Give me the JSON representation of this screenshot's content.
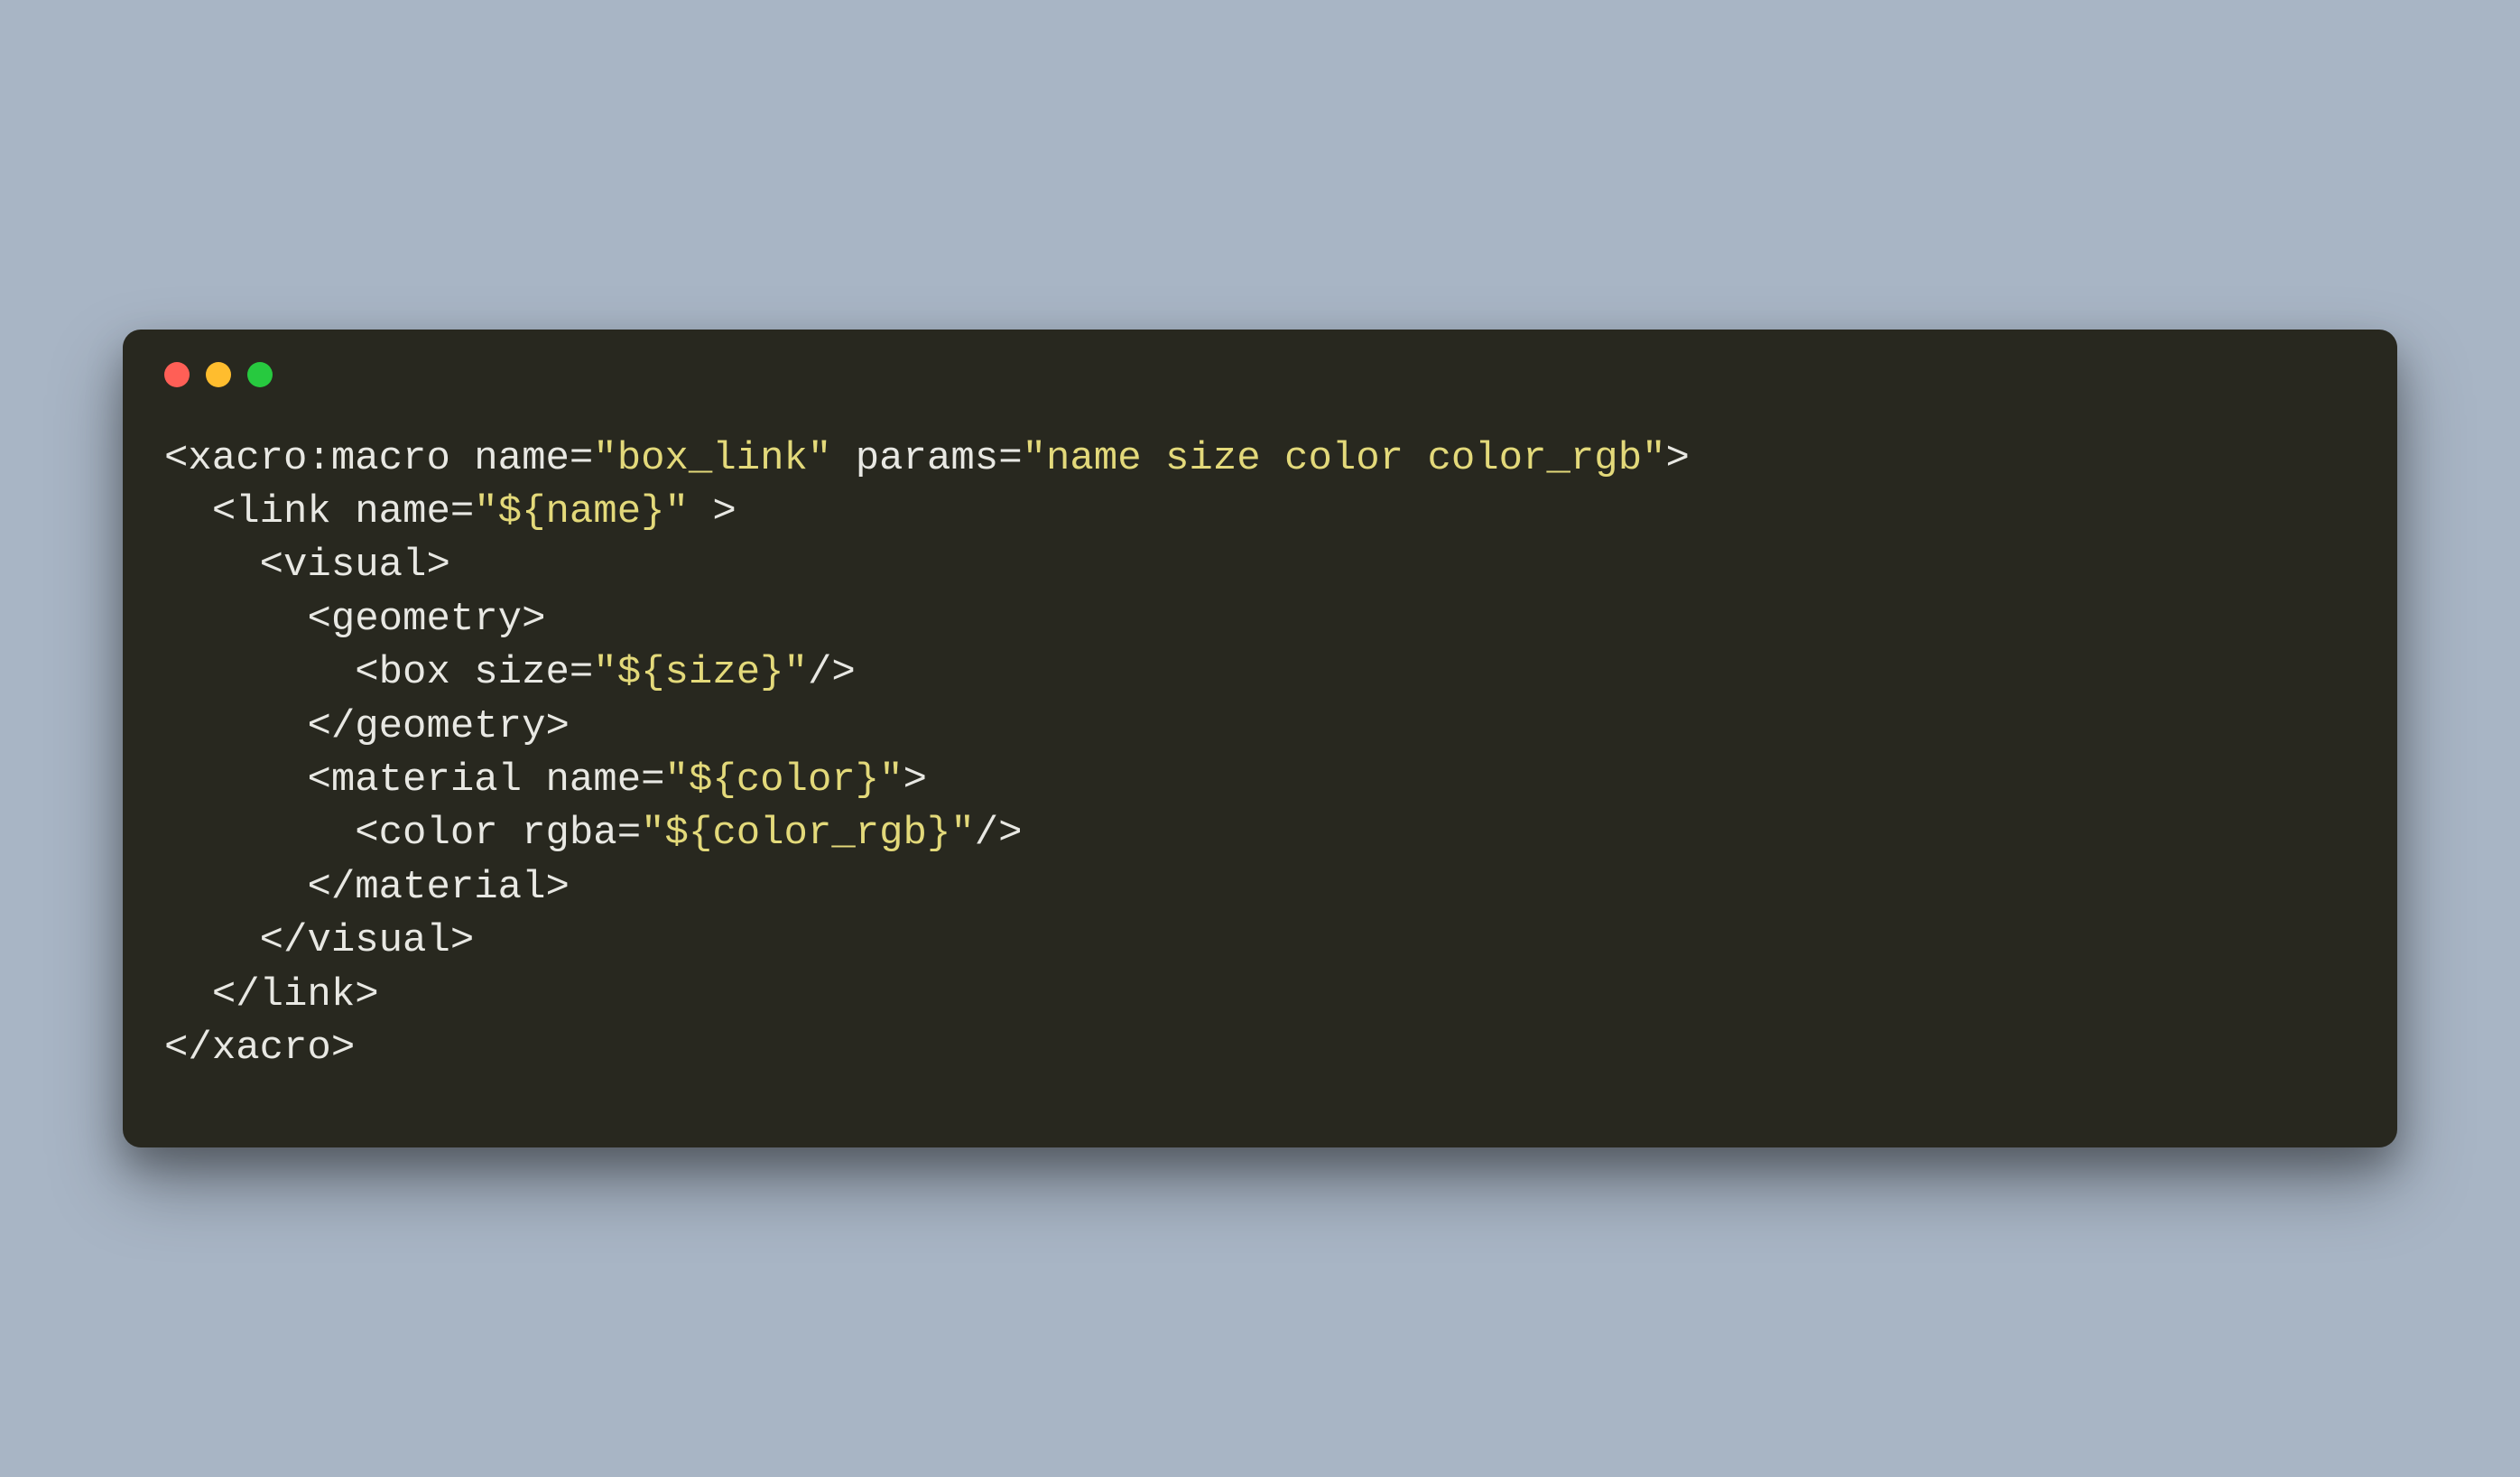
{
  "window": {
    "controls": {
      "close": "close",
      "minimize": "minimize",
      "maximize": "maximize"
    }
  },
  "code": {
    "lines": [
      {
        "indent": 0,
        "tokens": [
          {
            "t": "punct",
            "v": "<"
          },
          {
            "t": "tag",
            "v": "xacro:macro"
          },
          {
            "t": "punct",
            "v": " "
          },
          {
            "t": "attr",
            "v": "name"
          },
          {
            "t": "punct",
            "v": "="
          },
          {
            "t": "string",
            "v": "\"box_link\""
          },
          {
            "t": "punct",
            "v": " "
          },
          {
            "t": "attr",
            "v": "params"
          },
          {
            "t": "punct",
            "v": "="
          },
          {
            "t": "string",
            "v": "\"name size color color_rgb\""
          },
          {
            "t": "punct",
            "v": ">"
          }
        ]
      },
      {
        "indent": 1,
        "tokens": [
          {
            "t": "punct",
            "v": "<"
          },
          {
            "t": "tag",
            "v": "link"
          },
          {
            "t": "punct",
            "v": " "
          },
          {
            "t": "attr",
            "v": "name"
          },
          {
            "t": "punct",
            "v": "="
          },
          {
            "t": "string",
            "v": "\"${name}\""
          },
          {
            "t": "punct",
            "v": " >"
          }
        ]
      },
      {
        "indent": 2,
        "tokens": [
          {
            "t": "punct",
            "v": "<"
          },
          {
            "t": "tag",
            "v": "visual"
          },
          {
            "t": "punct",
            "v": ">"
          }
        ]
      },
      {
        "indent": 3,
        "tokens": [
          {
            "t": "punct",
            "v": "<"
          },
          {
            "t": "tag",
            "v": "geometry"
          },
          {
            "t": "punct",
            "v": ">"
          }
        ]
      },
      {
        "indent": 4,
        "tokens": [
          {
            "t": "punct",
            "v": "<"
          },
          {
            "t": "tag",
            "v": "box"
          },
          {
            "t": "punct",
            "v": " "
          },
          {
            "t": "attr",
            "v": "size"
          },
          {
            "t": "punct",
            "v": "="
          },
          {
            "t": "string",
            "v": "\"${size}\""
          },
          {
            "t": "punct",
            "v": "/>"
          }
        ]
      },
      {
        "indent": 3,
        "tokens": [
          {
            "t": "punct",
            "v": "</"
          },
          {
            "t": "tag",
            "v": "geometry"
          },
          {
            "t": "punct",
            "v": ">"
          }
        ]
      },
      {
        "indent": 3,
        "tokens": [
          {
            "t": "punct",
            "v": "<"
          },
          {
            "t": "tag",
            "v": "material"
          },
          {
            "t": "punct",
            "v": " "
          },
          {
            "t": "attr",
            "v": "name"
          },
          {
            "t": "punct",
            "v": "="
          },
          {
            "t": "string",
            "v": "\"${color}\""
          },
          {
            "t": "punct",
            "v": ">"
          }
        ]
      },
      {
        "indent": 4,
        "tokens": [
          {
            "t": "punct",
            "v": "<"
          },
          {
            "t": "tag",
            "v": "color"
          },
          {
            "t": "punct",
            "v": " "
          },
          {
            "t": "attr",
            "v": "rgba"
          },
          {
            "t": "punct",
            "v": "="
          },
          {
            "t": "string",
            "v": "\"${color_rgb}\""
          },
          {
            "t": "punct",
            "v": "/>"
          }
        ]
      },
      {
        "indent": 3,
        "tokens": [
          {
            "t": "punct",
            "v": "</"
          },
          {
            "t": "tag",
            "v": "material"
          },
          {
            "t": "punct",
            "v": ">"
          }
        ]
      },
      {
        "indent": 2,
        "tokens": [
          {
            "t": "punct",
            "v": "</"
          },
          {
            "t": "tag",
            "v": "visual"
          },
          {
            "t": "punct",
            "v": ">"
          }
        ]
      },
      {
        "indent": 1,
        "tokens": [
          {
            "t": "punct",
            "v": "</"
          },
          {
            "t": "tag",
            "v": "link"
          },
          {
            "t": "punct",
            "v": ">"
          }
        ]
      },
      {
        "indent": 0,
        "tokens": [
          {
            "t": "punct",
            "v": "</"
          },
          {
            "t": "tag",
            "v": "xacro"
          },
          {
            "t": "punct",
            "v": ">"
          }
        ]
      }
    ]
  }
}
